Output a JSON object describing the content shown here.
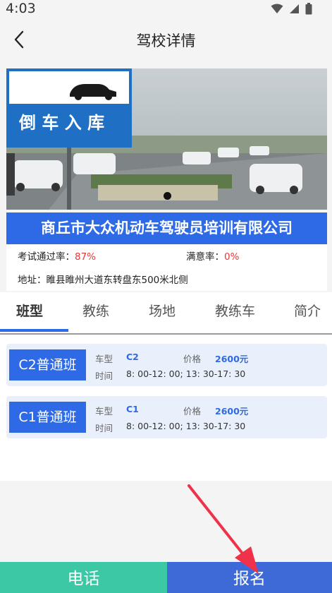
{
  "status_bar": {
    "time": "4:03"
  },
  "header": {
    "title": "驾校详情"
  },
  "banner": {
    "sign_text": "倒 车 入 库"
  },
  "school": {
    "name": "商丘市大众机动车驾驶员培训有限公司",
    "pass_rate_label": "考试通过率：",
    "pass_rate_value": "87%",
    "satisfaction_label": "满意率：",
    "satisfaction_value": "0%",
    "address": "地址：睢县睢州大道东转盘东500米北侧"
  },
  "tabs": [
    {
      "label": "班型",
      "active": true
    },
    {
      "label": "教练",
      "active": false
    },
    {
      "label": "场地",
      "active": false
    },
    {
      "label": "教练车",
      "active": false
    },
    {
      "label": "简介",
      "active": false
    }
  ],
  "classes": [
    {
      "name": "C2普通班",
      "car_type_label": "车型",
      "car_type": "C2",
      "price_label": "价格",
      "price": "2600元",
      "time_label": "时间",
      "time": "8: 00-12: 00; 13: 30-17: 30"
    },
    {
      "name": "C1普通班",
      "car_type_label": "车型",
      "car_type": "C1",
      "price_label": "价格",
      "price": "2600元",
      "time_label": "时间",
      "time": "8: 00-12: 00; 13: 30-17: 30"
    }
  ],
  "footer": {
    "phone_label": "电话",
    "signup_label": "报名"
  },
  "colors": {
    "primary": "#2e6ae6",
    "phone_btn": "#3cc8a5",
    "signup_btn": "#3e6ad8",
    "highlight_red": "#e53935",
    "annotation_arrow": "#f0314a"
  }
}
